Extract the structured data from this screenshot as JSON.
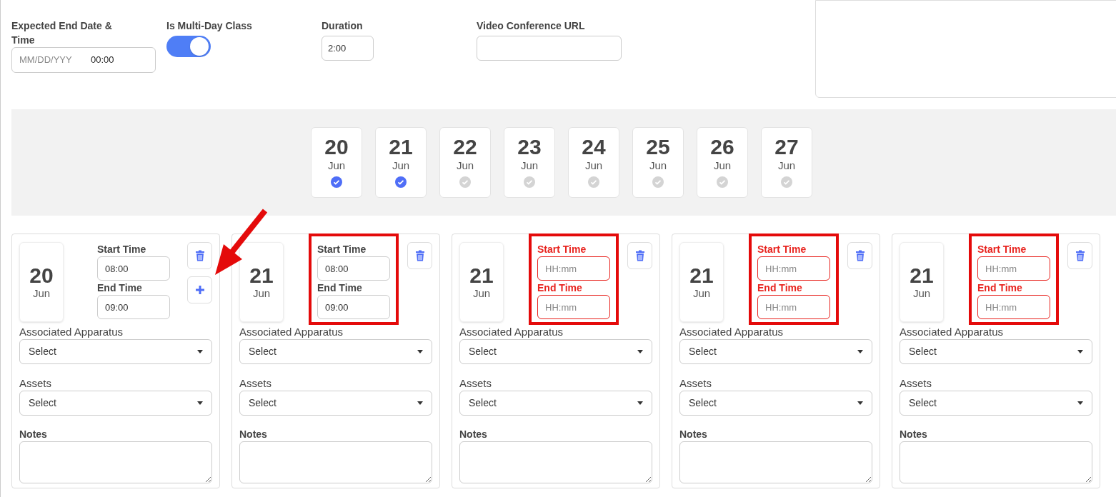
{
  "fields": [
    {
      "kind": "datetime",
      "label": "Expected End Date & Time",
      "placeholder": "MM/DD/YYY",
      "value": "00:00"
    },
    {
      "kind": "toggle",
      "label": "Is Multi-Day Class",
      "on": true
    },
    {
      "kind": "text",
      "label": "Duration",
      "value": "2:00"
    },
    {
      "kind": "url",
      "label": "Video Conference URL"
    }
  ],
  "date_picker": [
    {
      "day": "20",
      "month": "Jun",
      "checked": true
    },
    {
      "day": "21",
      "month": "Jun",
      "checked": true
    },
    {
      "day": "22",
      "month": "Jun",
      "checked": false
    },
    {
      "day": "23",
      "month": "Jun",
      "checked": false
    },
    {
      "day": "24",
      "month": "Jun",
      "checked": false
    },
    {
      "day": "25",
      "month": "Jun",
      "checked": false
    },
    {
      "day": "26",
      "month": "Jun",
      "checked": false
    },
    {
      "day": "27",
      "month": "Jun",
      "checked": false
    }
  ],
  "slots": [
    {
      "day": "20",
      "month": "Jun",
      "start_label": "Start Time",
      "start_value": "08:00",
      "end_label": "End Time",
      "end_value": "09:00",
      "error": false,
      "highlighted": false,
      "add_button": true,
      "apparatus_label": "Associated Apparatus",
      "apparatus_value": "Select",
      "assets_label": "Assets",
      "assets_value": "Select",
      "notes_label": "Notes"
    },
    {
      "day": "21",
      "month": "Jun",
      "start_label": "Start Time",
      "start_value": "08:00",
      "end_label": "End Time",
      "end_value": "09:00",
      "error": false,
      "highlighted": true,
      "add_button": false,
      "apparatus_label": "Associated Apparatus",
      "apparatus_value": "Select",
      "assets_label": "Assets",
      "assets_value": "Select",
      "notes_label": "Notes"
    },
    {
      "day": "21",
      "month": "Jun",
      "start_label": "Start Time",
      "start_placeholder": "HH:mm",
      "end_label": "End Time",
      "end_placeholder": "HH:mm",
      "error": true,
      "highlighted": true,
      "add_button": false,
      "apparatus_label": "Associated Apparatus",
      "apparatus_value": "Select",
      "assets_label": "Assets",
      "assets_value": "Select",
      "notes_label": "Notes"
    },
    {
      "day": "21",
      "month": "Jun",
      "start_label": "Start Time",
      "start_placeholder": "HH:mm",
      "end_label": "End Time",
      "end_placeholder": "HH:mm",
      "error": true,
      "highlighted": true,
      "add_button": false,
      "apparatus_label": "Associated Apparatus",
      "apparatus_value": "Select",
      "assets_label": "Assets",
      "assets_value": "Select",
      "notes_label": "Notes"
    },
    {
      "day": "21",
      "month": "Jun",
      "start_label": "Start Time",
      "start_placeholder": "HH:mm",
      "end_label": "End Time",
      "end_placeholder": "HH:mm",
      "error": true,
      "highlighted": true,
      "add_button": false,
      "apparatus_label": "Associated Apparatus",
      "apparatus_value": "Select",
      "assets_label": "Assets",
      "assets_value": "Select",
      "notes_label": "Notes"
    }
  ],
  "annotation_arrow": true
}
